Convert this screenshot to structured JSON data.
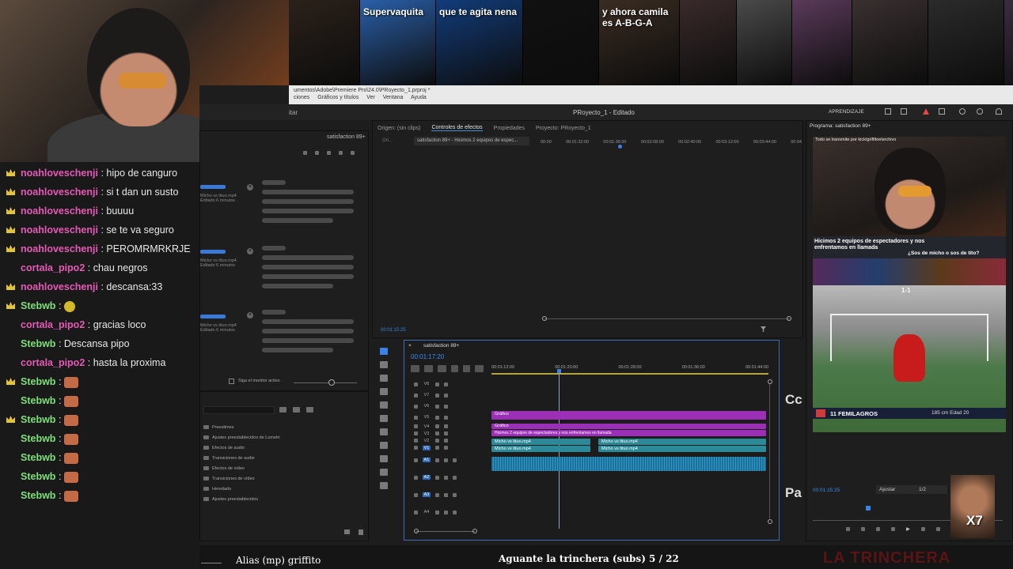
{
  "chat": {
    "messages": [
      {
        "user": "noahloveschenji",
        "text": ": hipo de canguro",
        "badge": "crown",
        "color": "pink"
      },
      {
        "user": "noahloveschenji",
        "text": ": si t dan un susto",
        "badge": "crown",
        "color": "pink"
      },
      {
        "user": "noahloveschenji",
        "text": ": buuuu",
        "badge": "crown",
        "color": "pink"
      },
      {
        "user": "noahloveschenji",
        "text": ": se te va seguro",
        "badge": "crown",
        "color": "pink"
      },
      {
        "user": "noahloveschenji",
        "text": ": PEROMRMRKRJE",
        "badge": "crown",
        "color": "pink"
      },
      {
        "user": "cortala_pipo2",
        "text": ": chau negros",
        "badge": "none",
        "color": "pink"
      },
      {
        "user": "noahloveschenji",
        "text": ": descansa:33",
        "badge": "crown",
        "color": "pink"
      },
      {
        "user": "Stebwb",
        "text": ":",
        "badge": "crown",
        "color": "green",
        "emote": "fear"
      },
      {
        "user": "cortala_pipo2",
        "text": ": gracias loco",
        "badge": "none",
        "color": "pink"
      },
      {
        "user": "Stebwb",
        "text": ": Descansa pipo",
        "badge": "none",
        "color": "green"
      },
      {
        "user": "cortala_pipo2",
        "text": ": hasta la proxima",
        "badge": "none",
        "color": "pink"
      },
      {
        "user": "Stebwb",
        "text": ":",
        "badge": "crown",
        "color": "green",
        "emote": "face"
      },
      {
        "user": "Stebwb",
        "text": ":",
        "badge": "none",
        "color": "green",
        "emote": "face"
      },
      {
        "user": "Stebwb",
        "text": ":",
        "badge": "crown",
        "color": "green",
        "emote": "face"
      },
      {
        "user": "Stebwb",
        "text": ":",
        "badge": "none",
        "color": "green",
        "emote": "face"
      },
      {
        "user": "Stebwb",
        "text": ":",
        "badge": "none",
        "color": "green",
        "emote": "face"
      },
      {
        "user": "Stebwb",
        "text": ":",
        "badge": "none",
        "color": "green",
        "emote": "face"
      },
      {
        "user": "Stebwb",
        "text": ":",
        "badge": "none",
        "color": "green",
        "emote": "face"
      }
    ]
  },
  "thumbs": [
    {
      "label": "",
      "color": "#2b211a"
    },
    {
      "label": "Supervaquita",
      "color": "#2a5fa8"
    },
    {
      "label": "que te agita nena",
      "color": "#123c7a"
    },
    {
      "label": "",
      "color": "#111"
    },
    {
      "label": "y ahora camila es A-B-G-A",
      "color": "#3a2c22"
    },
    {
      "label": "",
      "color": "#3a2a2a"
    },
    {
      "label": "",
      "color": "#4a4a4a"
    },
    {
      "label": "",
      "color": "#5a3a5a"
    },
    {
      "label": "",
      "color": "#3a3030"
    },
    {
      "label": "",
      "color": "#2b2b2b"
    },
    {
      "label": "",
      "color": "#3a2c40"
    }
  ],
  "pathbar": {
    "path": "umentos\\Adobe\\Premiere Pro\\24.0\\PRoyecto_1.prproj *",
    "menu": [
      "ciones",
      "Gráficos y títulos",
      "Ver",
      "Ventana",
      "Ayuda"
    ]
  },
  "titlebar": {
    "left": "itar",
    "center": "PRoyecto_1 - Editado",
    "right": "APRENDIZAJE"
  },
  "source_tabs": [
    "Origen: (sin clips)",
    "Controles de efectos",
    "Propiedades",
    "Proyecto: PRoyecto_1"
  ],
  "effects": {
    "sequence": "satisfaction 89+ - Hicimos 2 equipos de espec...",
    "ruler": [
      "00:00",
      "00:01:32:00",
      "00:01:36:00",
      "00:02:08:00",
      "00:02:40:00",
      "00:03:12:00",
      "00:03:44:00",
      "00:04"
    ],
    "timecode": "00:01:15:25"
  },
  "left_panel": {
    "header": "satisfaction 89+",
    "items": [
      {
        "name": "Micho vs tituo.mp4",
        "sub": "Editado 6 minutos"
      },
      {
        "name": "Micho vs tituo.mp4",
        "sub": "Editado 6 minutos"
      },
      {
        "name": "Micho vs tituo.mp4",
        "sub": "Editado 6 minutos"
      }
    ],
    "follow": "Siga el monitor activo"
  },
  "project": {
    "items": [
      "Preestimes",
      "Ajustes preestablecidos de Lumetri",
      "Efectos de audio",
      "Transiciones de audio",
      "Efectos de vídeo",
      "Transiciones de vídeo",
      "Heredado",
      "Ajustes preestablecidos"
    ]
  },
  "timeline": {
    "title": "satisfaction 89+",
    "timecode": "00:01:17:20",
    "ruler": [
      "00:01:12:00",
      "00:01:20:00",
      "00:01:28:00",
      "00:01:36:00",
      "00:01:44:00"
    ],
    "tracks": [
      {
        "id": "V6",
        "type": "v"
      },
      {
        "id": "V7",
        "type": "v"
      },
      {
        "id": "V6",
        "type": "v"
      },
      {
        "id": "V5",
        "type": "v"
      },
      {
        "id": "V4",
        "type": "v"
      },
      {
        "id": "V3",
        "type": "v"
      },
      {
        "id": "V2",
        "type": "v"
      },
      {
        "id": "V1",
        "type": "v"
      },
      {
        "id": "A1",
        "type": "a"
      },
      {
        "id": "A2",
        "type": "a"
      },
      {
        "id": "A3",
        "type": "a"
      },
      {
        "id": "A4",
        "type": "a"
      }
    ],
    "clips": {
      "grafico1": "Gráfico",
      "grafico2": "Gráfico",
      "text": "Hicimos 2 equipos de espectadores y nos enfrentamos en llamada",
      "v2a": "Micho vs tituo.mp4",
      "v2b": "Micho vs tituo.mp4",
      "v1a": "Micho vs tituo.mp4",
      "v1b": "Micho vs tituo.mp4"
    }
  },
  "side_labels": {
    "top": "Cc",
    "bottom": "Pa"
  },
  "program": {
    "title": "Programa: satisfaction 89+",
    "banner": "Todo se transmite por kick/griffitoelarchivo",
    "caption": "Hicimos 2 equipos de espectadores y nos enfrentamos en llamada",
    "question": "¿Sos de micho o sos de tito?",
    "score": "1-1",
    "player": "11 FEMILAGROS",
    "height": "185 cm Edad 20",
    "timecode": "00:01:15:25",
    "fit": "Ajustar",
    "ratio": "1/2",
    "sticker": "X7"
  },
  "bottom": {
    "credit": "Alias (mp) griffito",
    "song": "Aguante la trinchera (subs) 5 / 22",
    "brand": "LA TRINCHERA"
  }
}
